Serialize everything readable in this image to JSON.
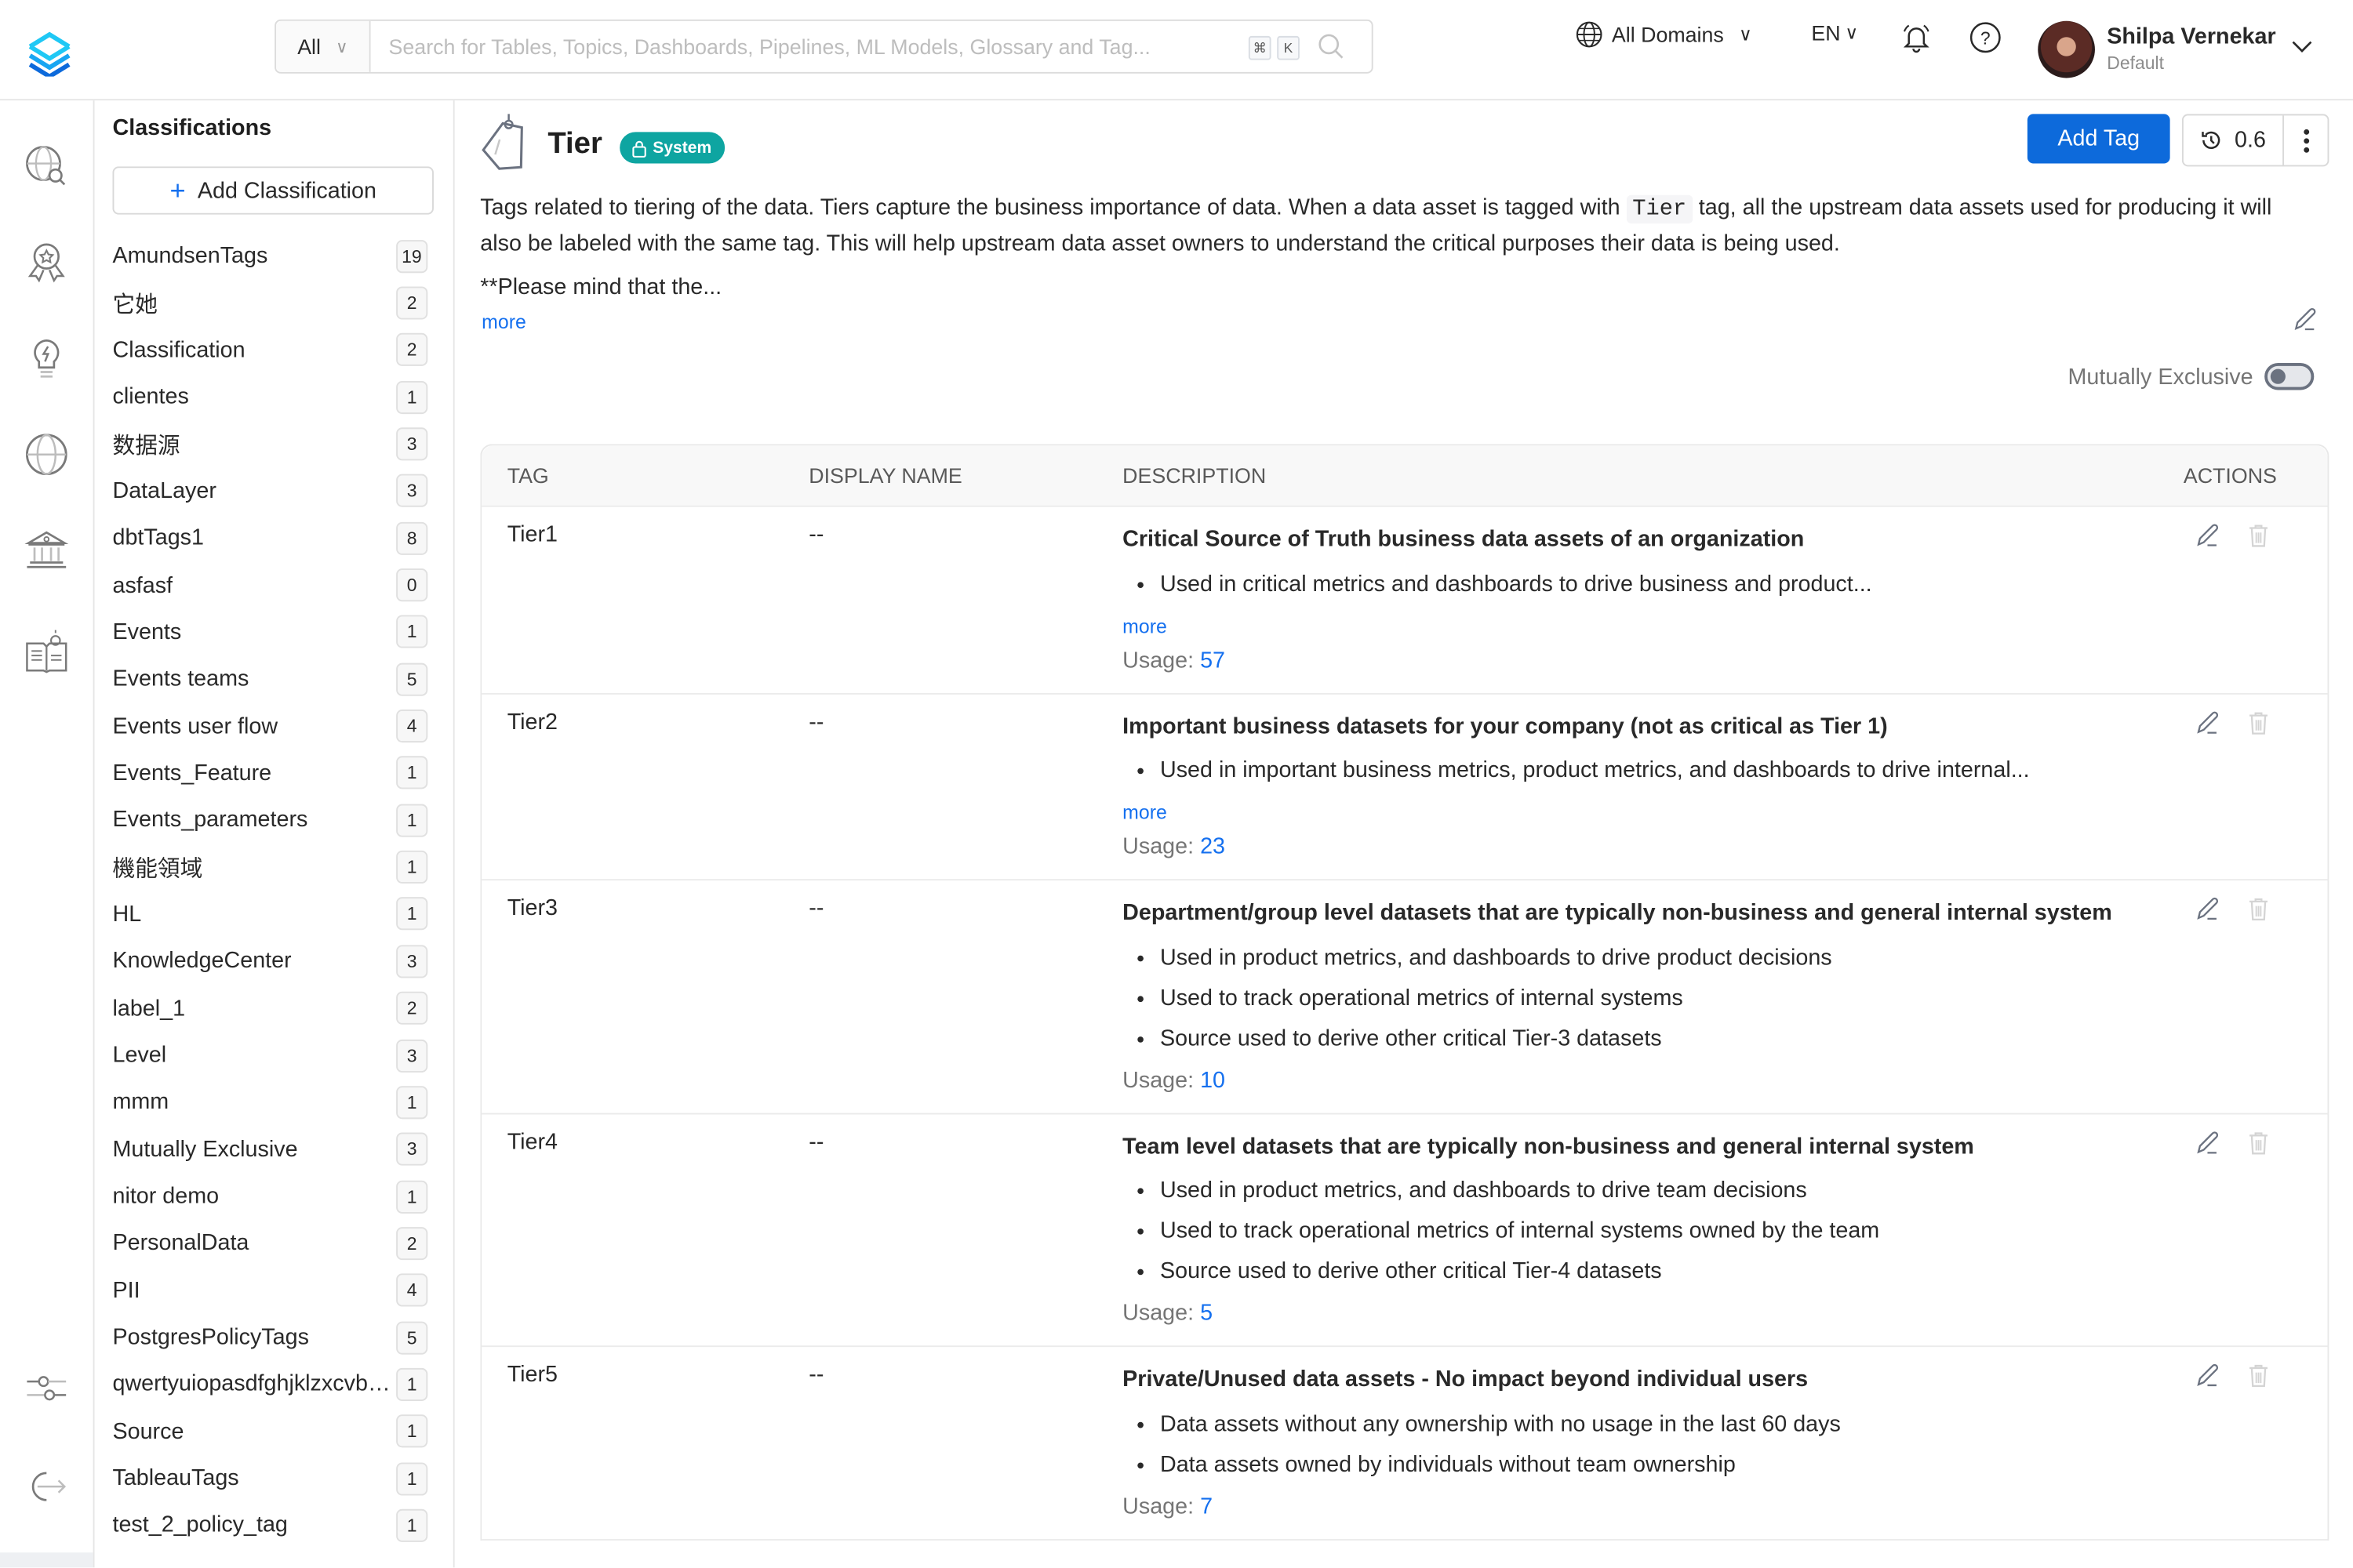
{
  "header": {
    "search_scope": "All",
    "search_placeholder": "Search for Tables, Topics, Dashboards, Pipelines, ML Models, Glossary and Tag...",
    "shortcut_keys": [
      "⌘",
      "K"
    ],
    "domains_label": "All Domains",
    "language": "EN",
    "user_name": "Shilpa Vernekar",
    "user_role": "Default"
  },
  "leftnav": {
    "icons": [
      "explore-icon",
      "data-quality-icon",
      "insights-icon",
      "domains-icon",
      "governance-icon",
      "knowledge-icon"
    ],
    "bottom_icons": [
      "settings-icon",
      "logout-icon"
    ]
  },
  "classifications": {
    "title": "Classifications",
    "add_label": "Add Classification",
    "items": [
      {
        "name": "AmundsenTags",
        "count": "19"
      },
      {
        "name": "它她",
        "count": "2"
      },
      {
        "name": "Classification",
        "count": "2"
      },
      {
        "name": "clientes",
        "count": "1"
      },
      {
        "name": "数据源",
        "count": "3"
      },
      {
        "name": "DataLayer",
        "count": "3"
      },
      {
        "name": "dbtTags1",
        "count": "8"
      },
      {
        "name": "asfasf",
        "count": "0"
      },
      {
        "name": "Events",
        "count": "1"
      },
      {
        "name": "Events teams",
        "count": "5"
      },
      {
        "name": "Events user flow",
        "count": "4"
      },
      {
        "name": "Events_Feature",
        "count": "1"
      },
      {
        "name": "Events_parameters",
        "count": "1"
      },
      {
        "name": "機能領域",
        "count": "1"
      },
      {
        "name": "HL",
        "count": "1"
      },
      {
        "name": "KnowledgeCenter",
        "count": "3"
      },
      {
        "name": "label_1",
        "count": "2"
      },
      {
        "name": "Level",
        "count": "3"
      },
      {
        "name": "mmm",
        "count": "1"
      },
      {
        "name": "Mutually Exclusive",
        "count": "3"
      },
      {
        "name": "nitor demo",
        "count": "1"
      },
      {
        "name": "PersonalData",
        "count": "2"
      },
      {
        "name": "PII",
        "count": "4"
      },
      {
        "name": "PostgresPolicyTags",
        "count": "5"
      },
      {
        "name": "qwertyuiopasdfghjklzxcvbnm",
        "count": "1"
      },
      {
        "name": "Source",
        "count": "1"
      },
      {
        "name": "TableauTags",
        "count": "1"
      },
      {
        "name": "test_2_policy_tag",
        "count": "1"
      }
    ]
  },
  "main": {
    "title": "Tier",
    "badge": "System",
    "add_tag_label": "Add Tag",
    "version": "0.6",
    "description_before_code": "Tags related to tiering of the data. Tiers capture the business importance of data. When a data asset is tagged with ",
    "description_code": "Tier",
    "description_after_code": " tag, all the upstream data assets used for producing it will also be labeled with the same tag. This will help upstream data asset owners to understand the critical purposes their data is being used.",
    "description_truncated": "**Please mind that the...",
    "more_label": "more",
    "mutually_exclusive_label": "Mutually Exclusive",
    "mutually_exclusive_on": false
  },
  "table": {
    "columns": [
      "TAG",
      "DISPLAY NAME",
      "DESCRIPTION",
      "ACTIONS"
    ],
    "usage_label": "Usage:",
    "more_label": "more",
    "rows": [
      {
        "tag": "Tier1",
        "display_name": "--",
        "title": "Critical Source of Truth business data assets of an organization",
        "bullets": [
          "Used in critical metrics and dashboards to drive business and product..."
        ],
        "has_more": true,
        "usage": "57"
      },
      {
        "tag": "Tier2",
        "display_name": "--",
        "title": "Important business datasets for your company (not as critical as Tier 1)",
        "bullets": [
          "Used in important business metrics, product metrics, and dashboards to drive internal..."
        ],
        "has_more": true,
        "usage": "23"
      },
      {
        "tag": "Tier3",
        "display_name": "--",
        "title": "Department/group level datasets that are typically non-business and general internal system",
        "bullets": [
          "Used in product metrics, and dashboards to drive product decisions",
          "Used to track operational metrics of internal systems",
          "Source used to derive other critical Tier-3 datasets"
        ],
        "has_more": false,
        "usage": "10"
      },
      {
        "tag": "Tier4",
        "display_name": "--",
        "title": "Team level datasets that are typically non-business and general internal system",
        "bullets": [
          "Used in product metrics, and dashboards to drive team decisions",
          "Used to track operational metrics of internal systems owned by the team",
          "Source used to derive other critical Tier-4 datasets"
        ],
        "has_more": false,
        "usage": "5"
      },
      {
        "tag": "Tier5",
        "display_name": "--",
        "title": "Private/Unused data assets - No impact beyond individual users",
        "bullets": [
          "Data assets without any ownership with no usage in the last 60 days",
          "Data assets owned by individuals without team ownership"
        ],
        "has_more": false,
        "usage": "7"
      }
    ]
  },
  "colors": {
    "primary": "#0d6adb",
    "link": "#1570ef",
    "system_badge": "#0ea5a1"
  }
}
